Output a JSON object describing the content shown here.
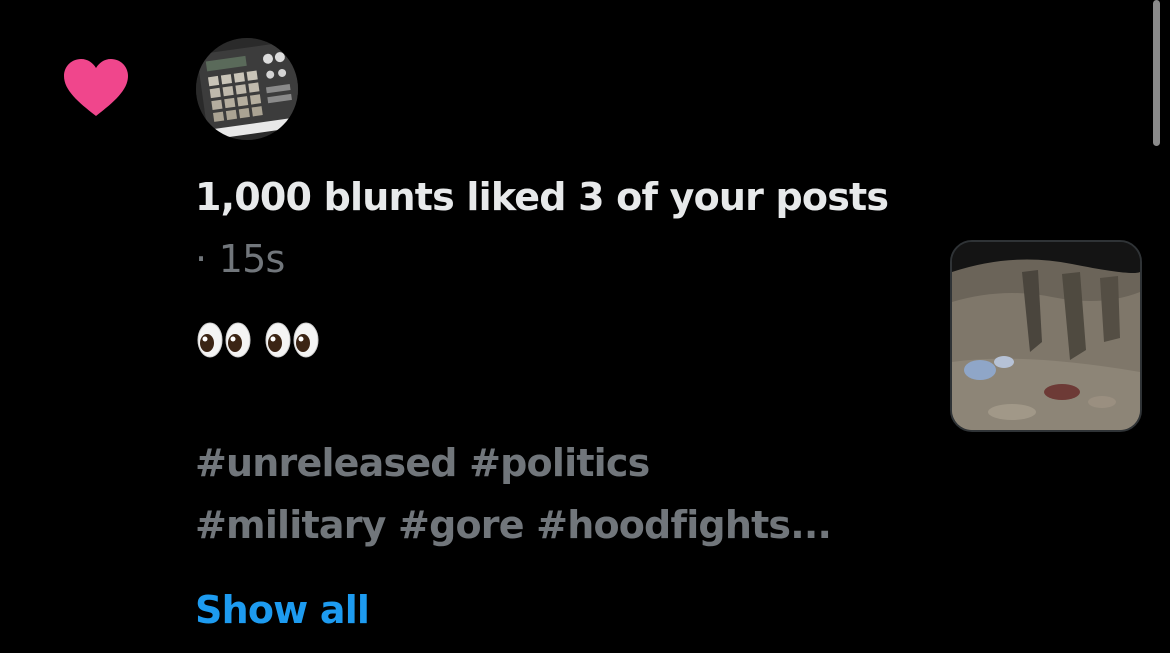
{
  "notification": {
    "actor": "1,000 blunts",
    "action_text": "liked 3 of your posts",
    "separator": "·",
    "time_ago": "15s",
    "emoji_text": "👀👀",
    "hashtags_line1": "#unreleased #politics",
    "hashtags_line2": "#military #gore #hoodfights...",
    "show_all_label": "Show all"
  },
  "icons": {
    "like_icon": "heart-icon",
    "avatar": "drum-machine-photo",
    "thumbnail": "post-media-thumbnail"
  },
  "colors": {
    "background": "#000000",
    "primary_text": "#e7e9ea",
    "secondary_text": "#71767b",
    "link": "#1d9bf0",
    "heart": "#f0468c"
  }
}
